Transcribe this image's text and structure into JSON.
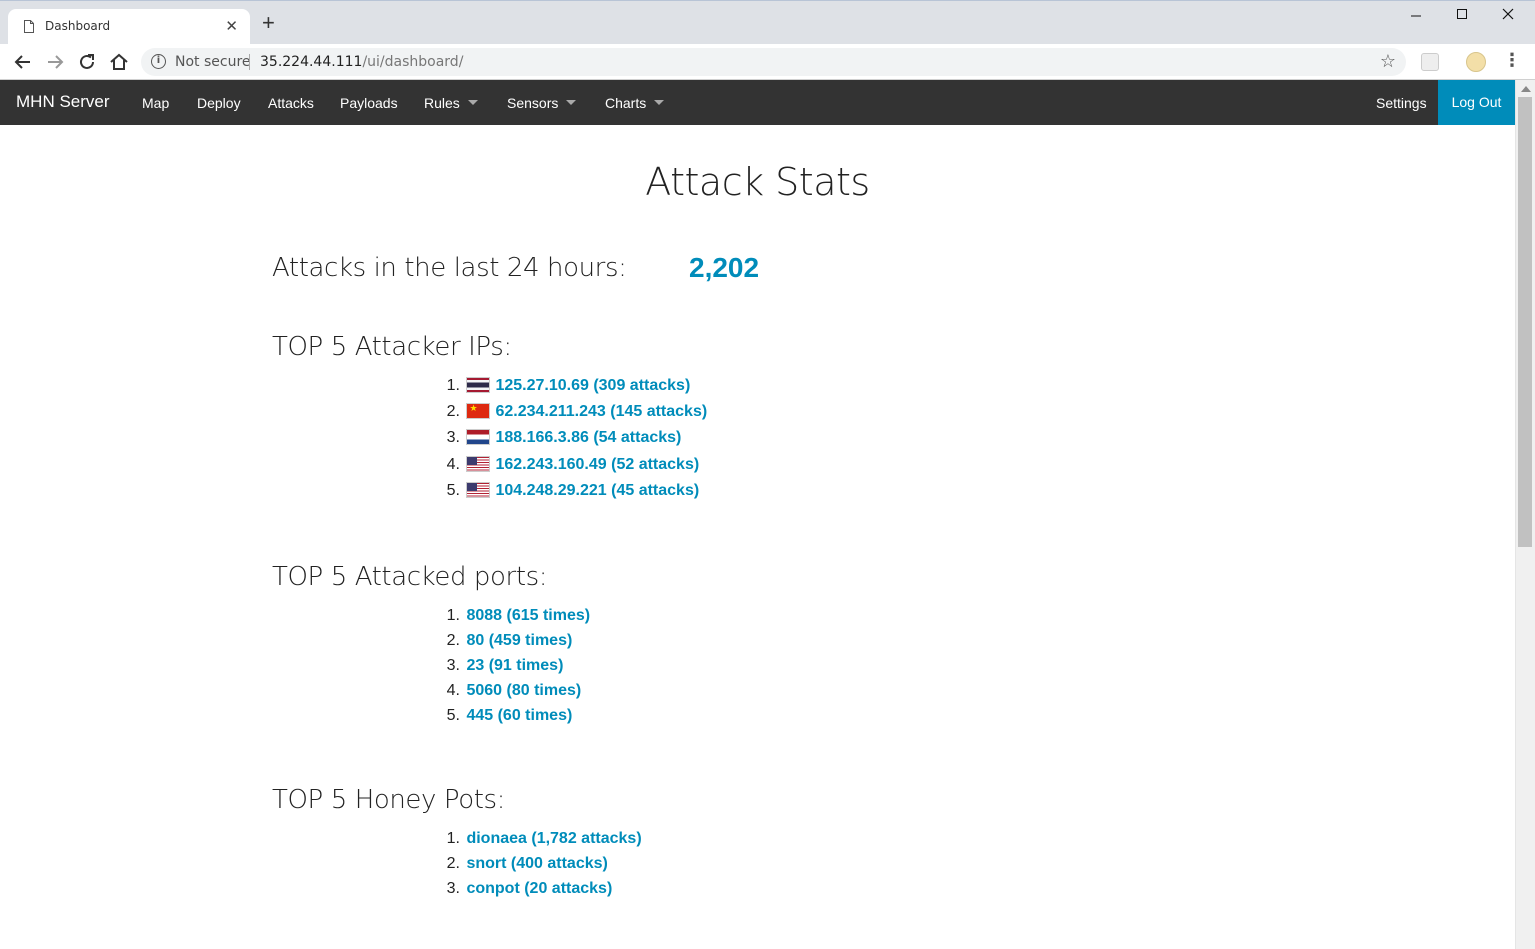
{
  "browser": {
    "tab_title": "Dashboard",
    "new_tab_label": "+",
    "security_label": "Not secure",
    "url_host": "35.224.44.111",
    "url_path": "/ui/dashboard/"
  },
  "navbar": {
    "brand": "MHN Server",
    "items": [
      {
        "label": "Map"
      },
      {
        "label": "Deploy"
      },
      {
        "label": "Attacks"
      },
      {
        "label": "Payloads"
      },
      {
        "label": "Rules",
        "dropdown": true
      },
      {
        "label": "Sensors",
        "dropdown": true
      },
      {
        "label": "Charts",
        "dropdown": true
      }
    ],
    "settings_label": "Settings",
    "logout_label": "Log Out",
    "accent_color": "#008cba",
    "background_color": "#333333"
  },
  "page": {
    "title": "Attack Stats",
    "attacks_24h_label": "Attacks in the last 24 hours:",
    "attacks_24h_value": "2,202",
    "top_ips": {
      "heading": "TOP 5 Attacker IPs:",
      "rows": [
        {
          "num": "1.",
          "flag": "thailand-flag-icon",
          "text": "125.27.10.69 (309 attacks)"
        },
        {
          "num": "2.",
          "flag": "china-flag-icon",
          "text": "62.234.211.243 (145 attacks)"
        },
        {
          "num": "3.",
          "flag": "netherlands-flag-icon",
          "text": "188.166.3.86 (54 attacks)"
        },
        {
          "num": "4.",
          "flag": "usa-flag-icon",
          "text": "162.243.160.49 (52 attacks)"
        },
        {
          "num": "5.",
          "flag": "usa-flag-icon",
          "text": "104.248.29.221 (45 attacks)"
        }
      ]
    },
    "top_ports": {
      "heading": "TOP 5 Attacked ports:",
      "rows": [
        {
          "num": "1.",
          "text": "8088 (615 times)"
        },
        {
          "num": "2.",
          "text": "80 (459 times)"
        },
        {
          "num": "3.",
          "text": "23 (91 times)"
        },
        {
          "num": "4.",
          "text": "5060 (80 times)"
        },
        {
          "num": "5.",
          "text": "445 (60 times)"
        }
      ]
    },
    "top_honeypots": {
      "heading": "TOP 5 Honey Pots:",
      "rows": [
        {
          "num": "1.",
          "text": "dionaea (1,782 attacks)"
        },
        {
          "num": "2.",
          "text": "snort (400 attacks)"
        },
        {
          "num": "3.",
          "text": "conpot (20 attacks)"
        }
      ]
    }
  }
}
